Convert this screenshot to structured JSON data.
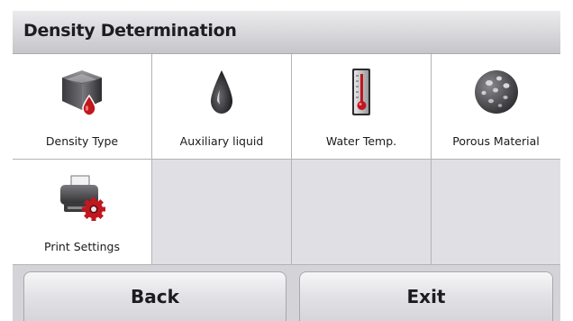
{
  "header": {
    "title": "Density Determination"
  },
  "menu": {
    "items": [
      {
        "label": "Density Type",
        "icon": "density-cube-icon"
      },
      {
        "label": "Auxiliary liquid",
        "icon": "liquid-drop-icon"
      },
      {
        "label": "Water Temp.",
        "icon": "thermometer-icon"
      },
      {
        "label": "Porous Material",
        "icon": "porous-rock-icon"
      },
      {
        "label": "Print Settings",
        "icon": "printer-settings-icon"
      }
    ]
  },
  "footer": {
    "back_label": "Back",
    "exit_label": "Exit"
  },
  "colors": {
    "accent_red": "#c0181f",
    "background": "#e2e2e4"
  }
}
